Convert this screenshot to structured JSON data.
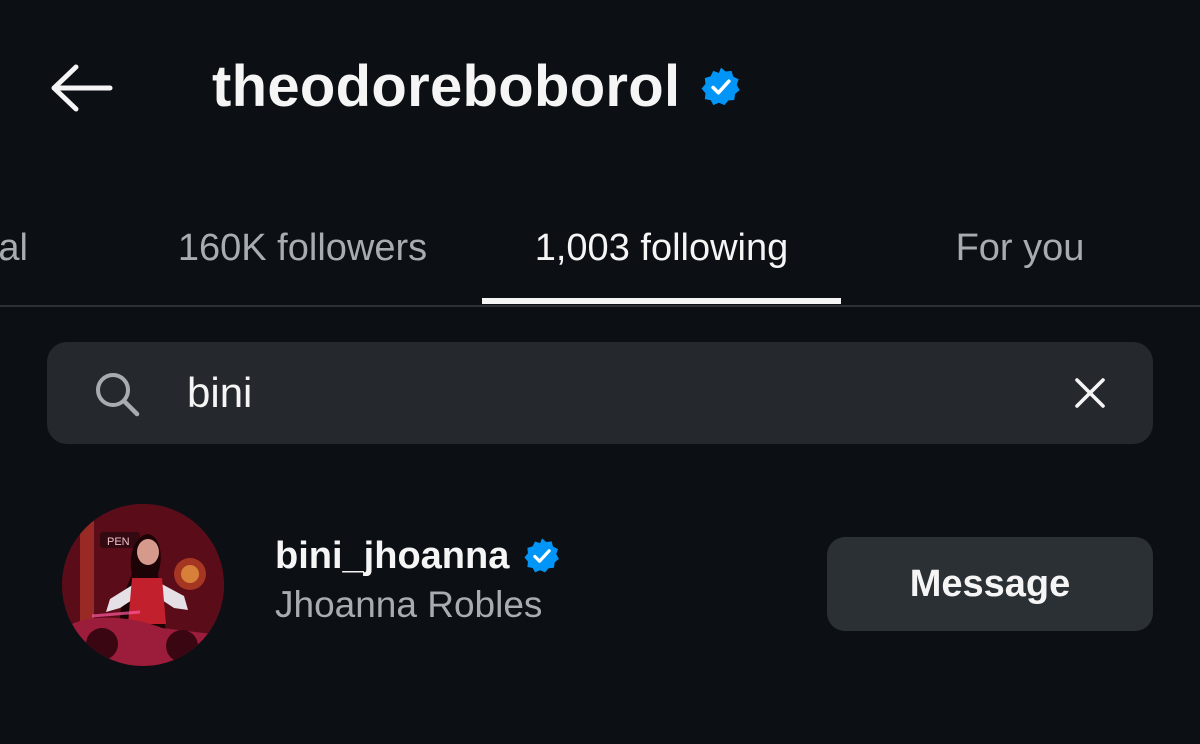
{
  "header": {
    "back_icon": "arrow-left-icon",
    "title": "theodoreboborol",
    "verified_icon": "verified-badge-icon"
  },
  "tabs": [
    {
      "label": "al",
      "active": false
    },
    {
      "label": "160K followers",
      "active": false
    },
    {
      "label": "1,003 following",
      "active": true
    },
    {
      "label": "For you",
      "active": false
    }
  ],
  "search": {
    "icon": "search-icon",
    "value": "bini",
    "clear_icon": "close-icon"
  },
  "results": [
    {
      "avatar": "profile-photo",
      "username": "bini_jhoanna",
      "verified_icon": "verified-badge-icon",
      "full_name": "Jhoanna Robles",
      "action_label": "Message"
    }
  ],
  "colors": {
    "background": "#0c1014",
    "primary_text": "#f5f5f5",
    "secondary_text": "#a8acb1",
    "search_background": "#25292e",
    "button_background": "#2b3035",
    "verified_blue": "#0095f6",
    "divider": "#2c3035"
  }
}
